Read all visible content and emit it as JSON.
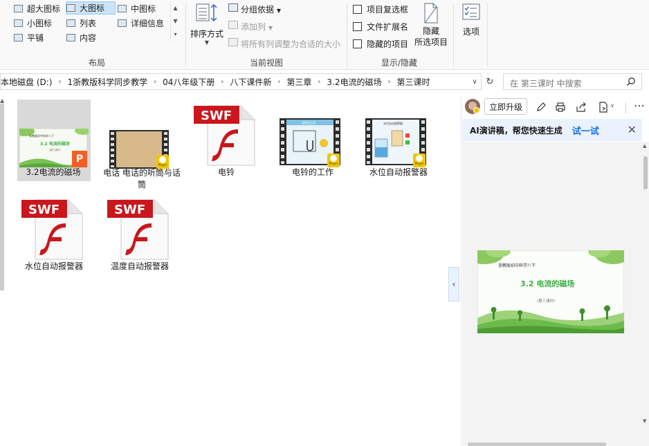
{
  "ribbon": {
    "layout": {
      "items": [
        {
          "label": "超大图标"
        },
        {
          "label": "大图标"
        },
        {
          "label": "中图标"
        },
        {
          "label": "小图标"
        },
        {
          "label": "列表"
        },
        {
          "label": "详细信息"
        },
        {
          "label": "平铺"
        },
        {
          "label": "内容"
        }
      ],
      "group_label": "布局"
    },
    "current_view": {
      "sort_label": "排序方式",
      "group_by_label": "分组依据",
      "add_column_label": "添加列",
      "autosize_label": "将所有列调整为合适的大小",
      "group_label": "当前视图"
    },
    "show_hide": {
      "checkboxes": [
        {
          "label": "项目复选框",
          "checked": false
        },
        {
          "label": "文件扩展名",
          "checked": false
        },
        {
          "label": "隐藏的项目",
          "checked": false
        }
      ],
      "hide_selected_line1": "隐藏",
      "hide_selected_line2": "所选项目",
      "group_label": "显示/隐藏"
    },
    "options_label": "选项"
  },
  "address": {
    "crumbs": [
      "本地磁盘 (D:)",
      "1浙教版科学同步教学",
      "04八年级下册",
      "八下课件新",
      "第三章",
      "3.2电流的磁场",
      "第三课时"
    ]
  },
  "search": {
    "placeholder": "在 第三课时 中搜索"
  },
  "files": [
    {
      "name": "3.2电流的磁场",
      "type": "pptx"
    },
    {
      "name": "电话 电话的听筒与话筒",
      "type": "video"
    },
    {
      "name": "电铃",
      "type": "swf"
    },
    {
      "name": "电铃的工作",
      "type": "video"
    },
    {
      "name": "水位自动报警器",
      "type": "video"
    },
    {
      "name": "水位自动报警器",
      "type": "swf"
    },
    {
      "name": "温度自动报警器",
      "type": "swf"
    }
  ],
  "thumb_text": {
    "ppt_header": "浙教版初中科学八下",
    "ppt_title": "3.2 电流的磁场",
    "ppt_sub": "(第三课时)",
    "swf_badge": "SWF",
    "player_badge": "Player",
    "bell_header": "电铃的工作",
    "water_header": "水位自动报警器"
  },
  "preview": {
    "upgrade_label": "立即升级",
    "banner_text": "AI演讲稿，帮您快速生成",
    "banner_link": "试一试",
    "slide_header": "浙教版初中科学八下",
    "slide_title": "3.2  电流的磁场",
    "slide_sub": "(第三课时)"
  },
  "colors": {
    "accent": "#0067c0",
    "selected_layout": "#cce4f7",
    "banner_bg": "#eaf2fd",
    "swf_red": "#c9171d",
    "ppt_orange": "#f25f25",
    "slide_green": "#3fae49"
  }
}
